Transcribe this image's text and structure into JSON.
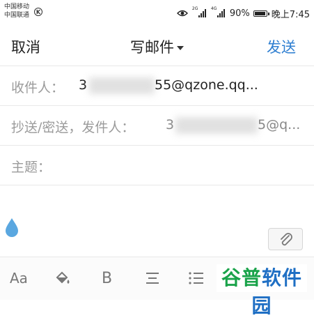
{
  "status_bar": {
    "carrier_1": "中国移动",
    "carrier_2": "中国联通",
    "k_badge": "K",
    "net_1": "2G",
    "net_2": "4G",
    "battery": "90%",
    "time": "晚上7:45"
  },
  "nav": {
    "cancel": "取消",
    "title": "写邮件",
    "send": "发送"
  },
  "form": {
    "to_label": "收件人：",
    "to_value_start": "3",
    "to_value_end": "55@qzone.qq...",
    "cc_label": "抄送/密送，发件人：",
    "cc_value_start": "3",
    "cc_value_end": "5@q...",
    "subject_label": "主题："
  },
  "toolbar": {
    "font_size": "Aa",
    "bold": "B"
  },
  "watermark": {
    "part_1": "谷普",
    "part_2": "软件园"
  },
  "colors": {
    "accent": "#2f7fd1",
    "drop": "#5aa7e0"
  }
}
